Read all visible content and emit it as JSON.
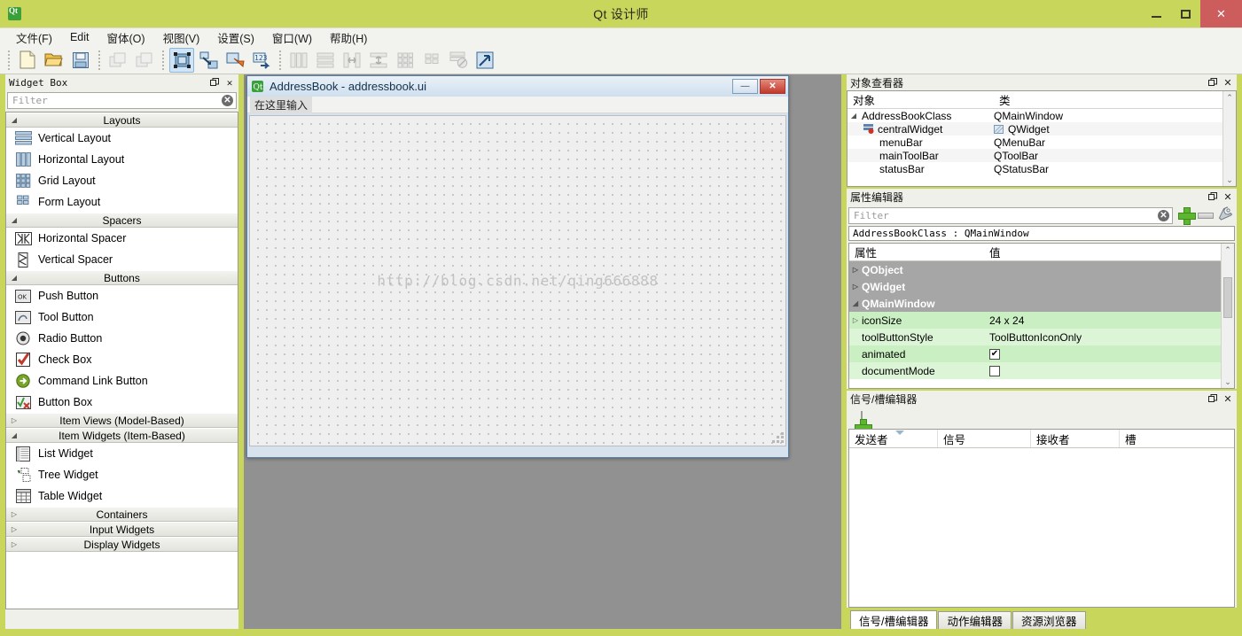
{
  "window": {
    "title": "Qt 设计师",
    "app_icon": "qt-logo-icon",
    "minimize": "–",
    "maximize": "□",
    "close": "✕",
    "titlebar_color": "#c9d65c"
  },
  "menubar": {
    "items": [
      {
        "label": "文件(F)",
        "name": "menu-file"
      },
      {
        "label": "Edit",
        "name": "menu-edit"
      },
      {
        "label": "窗体(O)",
        "name": "menu-form"
      },
      {
        "label": "视图(V)",
        "name": "menu-view"
      },
      {
        "label": "设置(S)",
        "name": "menu-settings"
      },
      {
        "label": "窗口(W)",
        "name": "menu-window"
      },
      {
        "label": "帮助(H)",
        "name": "menu-help"
      }
    ]
  },
  "toolbar": {
    "groups": [
      {
        "buttons": [
          {
            "name": "new-form-icon",
            "state": "enabled"
          },
          {
            "name": "open-form-icon",
            "state": "enabled"
          },
          {
            "name": "save-form-icon",
            "state": "enabled"
          }
        ]
      },
      {
        "buttons": [
          {
            "name": "undo-icon",
            "state": "disabled"
          },
          {
            "name": "redo-icon",
            "state": "disabled"
          }
        ]
      },
      {
        "buttons": [
          {
            "name": "edit-widgets-icon",
            "state": "active"
          },
          {
            "name": "edit-signals-slots-icon",
            "state": "enabled"
          },
          {
            "name": "edit-buddies-icon",
            "state": "enabled"
          },
          {
            "name": "edit-tab-order-icon",
            "state": "enabled"
          }
        ]
      },
      {
        "buttons": [
          {
            "name": "layout-horizontally-icon",
            "state": "disabled"
          },
          {
            "name": "layout-vertically-icon",
            "state": "disabled"
          },
          {
            "name": "layout-horizontal-splitter-icon",
            "state": "disabled"
          },
          {
            "name": "layout-vertical-splitter-icon",
            "state": "disabled"
          },
          {
            "name": "layout-grid-icon",
            "state": "disabled"
          },
          {
            "name": "layout-form-icon",
            "state": "disabled"
          },
          {
            "name": "break-layout-icon",
            "state": "disabled"
          },
          {
            "name": "adjust-size-icon",
            "state": "enabled"
          }
        ]
      }
    ]
  },
  "widget_box": {
    "title": "Widget Box",
    "undock_icon": "undock-icon",
    "close_icon": "close-icon",
    "filter": {
      "placeholder": "Filter",
      "value": "",
      "clear_icon": "clear-icon"
    },
    "categories": [
      {
        "label": "Layouts",
        "expanded": true,
        "name": "category-layouts",
        "items": [
          {
            "label": "Vertical Layout",
            "icon": "vertical-layout-icon"
          },
          {
            "label": "Horizontal Layout",
            "icon": "horizontal-layout-icon"
          },
          {
            "label": "Grid Layout",
            "icon": "grid-layout-icon"
          },
          {
            "label": "Form Layout",
            "icon": "form-layout-icon"
          }
        ]
      },
      {
        "label": "Spacers",
        "expanded": true,
        "name": "category-spacers",
        "items": [
          {
            "label": "Horizontal Spacer",
            "icon": "horizontal-spacer-icon"
          },
          {
            "label": "Vertical Spacer",
            "icon": "vertical-spacer-icon"
          }
        ]
      },
      {
        "label": "Buttons",
        "expanded": true,
        "name": "category-buttons",
        "items": [
          {
            "label": "Push Button",
            "icon": "push-button-icon"
          },
          {
            "label": "Tool Button",
            "icon": "tool-button-icon"
          },
          {
            "label": "Radio Button",
            "icon": "radio-button-icon"
          },
          {
            "label": "Check Box",
            "icon": "check-box-icon"
          },
          {
            "label": "Command Link Button",
            "icon": "command-link-button-icon"
          },
          {
            "label": "Button Box",
            "icon": "button-box-icon"
          }
        ]
      },
      {
        "label": "Item Views (Model-Based)",
        "expanded": false,
        "name": "category-item-views",
        "items": []
      },
      {
        "label": "Item Widgets (Item-Based)",
        "expanded": true,
        "name": "category-item-widgets",
        "items": [
          {
            "label": "List Widget",
            "icon": "list-widget-icon"
          },
          {
            "label": "Tree Widget",
            "icon": "tree-widget-icon"
          },
          {
            "label": "Table Widget",
            "icon": "table-widget-icon"
          }
        ]
      },
      {
        "label": "Containers",
        "expanded": false,
        "name": "category-containers",
        "items": []
      },
      {
        "label": "Input Widgets",
        "expanded": false,
        "name": "category-input-widgets",
        "items": []
      },
      {
        "label": "Display Widgets",
        "expanded": false,
        "name": "category-display-widgets",
        "items": []
      }
    ]
  },
  "form_window": {
    "title": "AddressBook - addressbook.ui",
    "icon": "qt-logo-icon",
    "minimize": "–",
    "close": "✕",
    "menubar_placeholder": "在这里输入",
    "watermark": "http://blog.csdn.net/qing666888"
  },
  "object_inspector": {
    "title": "对象查看器",
    "undock_icon": "undock-icon",
    "close_icon": "close-icon",
    "columns": [
      "对象",
      "类"
    ],
    "rows": [
      {
        "object": "AddressBookClass",
        "class": "QMainWindow",
        "indent": 0,
        "expander": "expanded",
        "icon": ""
      },
      {
        "object": "centralWidget",
        "class": "QWidget",
        "indent": 2,
        "expander": "none",
        "icon": "central-widget-icon"
      },
      {
        "object": "menuBar",
        "class": "QMenuBar",
        "indent": 1,
        "expander": "none",
        "icon": ""
      },
      {
        "object": "mainToolBar",
        "class": "QToolBar",
        "indent": 1,
        "expander": "none",
        "icon": ""
      },
      {
        "object": "statusBar",
        "class": "QStatusBar",
        "indent": 1,
        "expander": "none",
        "icon": ""
      }
    ]
  },
  "property_editor": {
    "title": "属性编辑器",
    "undock_icon": "undock-icon",
    "close_icon": "close-icon",
    "filter": {
      "placeholder": "Filter",
      "value": "",
      "clear_icon": "clear-icon"
    },
    "tools": [
      {
        "name": "add-property-button",
        "icon": "green-plus-icon"
      },
      {
        "name": "remove-property-button",
        "icon": "gray-minus-icon"
      },
      {
        "name": "configure-button",
        "icon": "wrench-icon"
      }
    ],
    "selected_object": "AddressBookClass : QMainWindow",
    "columns": [
      "属性",
      "值"
    ],
    "rows": [
      {
        "kind": "group",
        "name": "QObject",
        "value": "",
        "expander": "collapsed"
      },
      {
        "kind": "group",
        "name": "QWidget",
        "value": "",
        "expander": "collapsed"
      },
      {
        "kind": "group",
        "name": "QMainWindow",
        "value": "",
        "expander": "expanded"
      },
      {
        "kind": "prop",
        "name": "iconSize",
        "value": "24 x 24",
        "expander": "collapsed"
      },
      {
        "kind": "prop",
        "name": "toolButtonStyle",
        "value": "ToolButtonIconOnly",
        "expander": "none"
      },
      {
        "kind": "prop",
        "name": "animated",
        "value": "",
        "checkbox": true,
        "checked": true,
        "expander": "none"
      },
      {
        "kind": "prop",
        "name": "documentMode",
        "value": "",
        "checkbox": true,
        "checked": false,
        "expander": "none"
      }
    ]
  },
  "signal_slot_editor": {
    "title": "信号/槽编辑器",
    "undock_icon": "undock-icon",
    "close_icon": "close-icon",
    "tools": [
      {
        "name": "add-connection-button",
        "icon": "green-plus-icon"
      },
      {
        "name": "remove-connection-button",
        "icon": "gray-minus-icon"
      }
    ],
    "columns": [
      "发送者",
      "信号",
      "接收者",
      "槽"
    ],
    "rows": []
  },
  "bottom_tabs": [
    {
      "label": "信号/槽编辑器",
      "active": true,
      "name": "tab-signal-slot-editor"
    },
    {
      "label": "动作编辑器",
      "active": false,
      "name": "tab-action-editor"
    },
    {
      "label": "资源浏览器",
      "active": false,
      "name": "tab-resource-browser"
    }
  ],
  "colors": {
    "titlebar": "#c9d65c",
    "close_button": "#cd5c5c",
    "design_background": "#919191",
    "property_group": "#a6a6a6",
    "property_row": "#c9efc2",
    "toolbar_active": "#cfe4f7"
  }
}
